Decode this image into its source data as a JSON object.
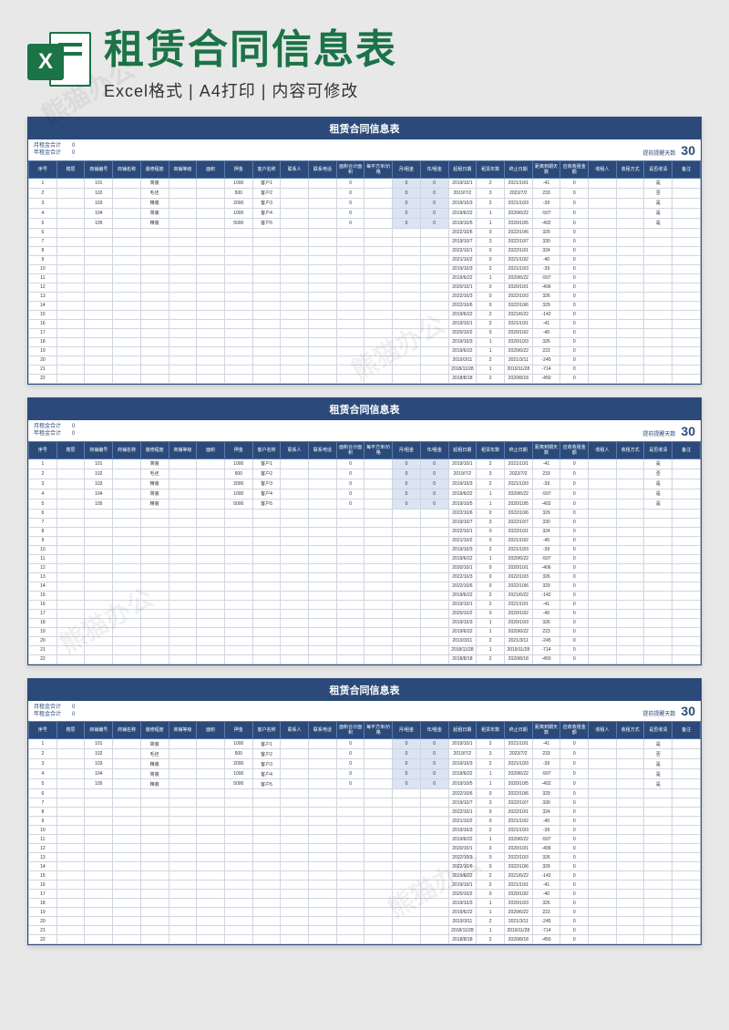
{
  "banner": {
    "title": "租赁合同信息表",
    "subtitle": "Excel格式 | A4打印 | 内容可修改",
    "icon_letter": "X"
  },
  "watermark_text": "熊猫办公",
  "sheet": {
    "title": "租赁合同信息表",
    "summary": {
      "monthly_label": "月租金合计",
      "monthly_value": "0",
      "yearly_label": "年租金合计",
      "yearly_value": "0",
      "reminder_label": "提前提醒天数",
      "reminder_value": "30"
    },
    "columns": [
      "序号",
      "楼层",
      "商铺编号",
      "商铺名称",
      "装修程度",
      "商铺等级",
      "面积",
      "押金",
      "客户名称",
      "联系人",
      "联系电话",
      "面积合计面积",
      "每平方米/价格",
      "月/租金",
      "年/租金",
      "起租日期",
      "租赁年数",
      "终止日期",
      "距离到期天数",
      "应收收租金额",
      "收租人",
      "收租方式",
      "是否收清",
      "备注"
    ],
    "rows": [
      {
        "n": 1,
        "floor": "",
        "code": "101",
        "name": "",
        "deco": "简装",
        "grade": "",
        "area": "",
        "deposit": "1000",
        "cust": "客户1",
        "start": "2019/10/1",
        "yrs": 2,
        "end": "2021/10/1",
        "days": -41,
        "paid": "是"
      },
      {
        "n": 2,
        "floor": "",
        "code": "102",
        "name": "",
        "deco": "毛坯",
        "grade": "",
        "area": "",
        "deposit": "500",
        "cust": "客户2",
        "start": "2019/7/2",
        "yrs": 3,
        "end": "2022/7/2",
        "days": 233,
        "paid": "否"
      },
      {
        "n": 3,
        "floor": "",
        "code": "103",
        "name": "",
        "deco": "精装",
        "grade": "",
        "area": "",
        "deposit": "2000",
        "cust": "客户3",
        "start": "2019/10/3",
        "yrs": 2,
        "end": "2021/10/3",
        "days": -39,
        "paid": "是"
      },
      {
        "n": 4,
        "floor": "",
        "code": "104",
        "name": "",
        "deco": "简装",
        "grade": "",
        "area": "",
        "deposit": "1000",
        "cust": "客户4",
        "start": "2019/6/22",
        "yrs": 1,
        "end": "2020/6/22",
        "days": -507,
        "paid": "是"
      },
      {
        "n": 5,
        "floor": "",
        "code": "105",
        "name": "",
        "deco": "精装",
        "grade": "",
        "area": "",
        "deposit": "5000",
        "cust": "客户5",
        "start": "2019/10/5",
        "yrs": 1,
        "end": "2020/10/5",
        "days": -402,
        "paid": "是"
      },
      {
        "n": 6,
        "start": "2022/10/6",
        "yrs": 0,
        "end": "2022/10/6",
        "days": 329
      },
      {
        "n": 7,
        "start": "2019/10/7",
        "yrs": 3,
        "end": "2022/10/7",
        "days": 330
      },
      {
        "n": 8,
        "start": "2022/10/1",
        "yrs": 0,
        "end": "2022/10/1",
        "days": 324
      },
      {
        "n": 9,
        "start": "2021/10/2",
        "yrs": 0,
        "end": "2021/10/2",
        "days": -40
      },
      {
        "n": 10,
        "start": "2019/10/3",
        "yrs": 2,
        "end": "2021/10/3",
        "days": -39
      },
      {
        "n": 11,
        "start": "2019/6/22",
        "yrs": 1,
        "end": "2020/6/22",
        "days": -507
      },
      {
        "n": 12,
        "start": "2020/10/1",
        "yrs": 0,
        "end": "2020/10/1",
        "days": -406
      },
      {
        "n": 13,
        "start": "2022/10/3",
        "yrs": 0,
        "end": "2022/10/3",
        "days": 326
      },
      {
        "n": 14,
        "start": "2022/10/6",
        "yrs": 0,
        "end": "2022/10/6",
        "days": 329
      },
      {
        "n": 15,
        "start": "2019/6/22",
        "yrs": 2,
        "end": "2021/6/22",
        "days": -142
      },
      {
        "n": 16,
        "start": "2019/10/1",
        "yrs": 2,
        "end": "2021/10/1",
        "days": -41
      },
      {
        "n": 17,
        "start": "2020/10/2",
        "yrs": 0,
        "end": "2020/10/2",
        "days": -40
      },
      {
        "n": 18,
        "start": "2019/10/3",
        "yrs": 1,
        "end": "2020/10/3",
        "days": 326
      },
      {
        "n": 19,
        "start": "2019/6/22",
        "yrs": 1,
        "end": "2020/6/22",
        "days": 223
      },
      {
        "n": 20,
        "start": "2019/3/11",
        "yrs": 2,
        "end": "2021/3/11",
        "days": -245
      },
      {
        "n": 21,
        "start": "2018/11/28",
        "yrs": 1,
        "end": "2019/11/28",
        "days": -714
      },
      {
        "n": 22,
        "start": "2018/8/18",
        "yrs": 2,
        "end": "2020/8/18",
        "days": -450
      }
    ]
  },
  "sheet_copies": 3
}
